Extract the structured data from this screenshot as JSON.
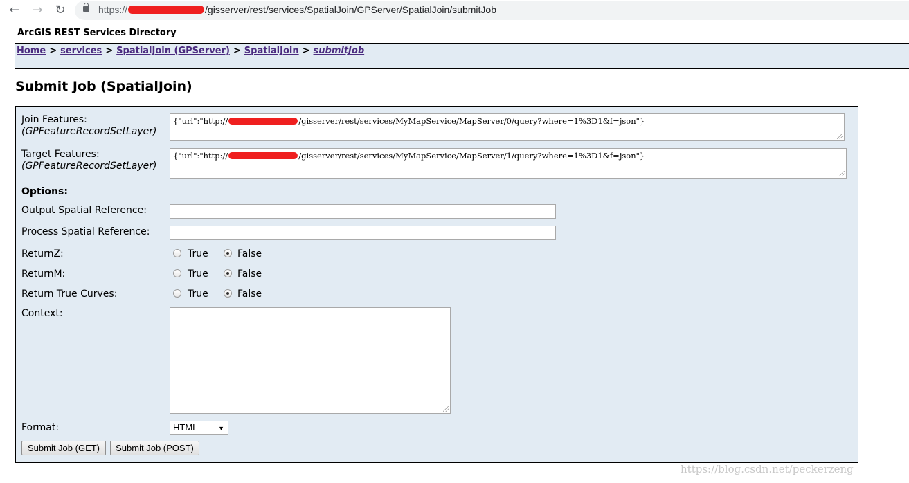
{
  "browser": {
    "url_scheme": "https://",
    "url_path": "/gisserver/rest/services/SpatialJoin/GPServer/SpatialJoin/submitJob"
  },
  "page": {
    "directory_title": "ArcGIS REST Services Directory",
    "breadcrumbs": {
      "home": "Home",
      "services": "services",
      "spatialjoin_gp": "SpatialJoin (GPServer)",
      "spatialjoin": "SpatialJoin",
      "current": "submitJob",
      "separator": ">"
    },
    "title": "Submit Job (SpatialJoin)"
  },
  "form": {
    "join_features": {
      "label": "Join Features:",
      "type": "(GPFeatureRecordSetLayer)",
      "value_prefix": "{\"url\":\"http://",
      "value_suffix": "/gisserver/rest/services/MyMapService/MapServer/0/query?where=1%3D1&f=json\"}"
    },
    "target_features": {
      "label": "Target Features:",
      "type": "(GPFeatureRecordSetLayer)",
      "value_prefix": "{\"url\":\"http://",
      "value_suffix": "/gisserver/rest/services/MyMapService/MapServer/1/query?where=1%3D1&f=json\"}"
    },
    "options_label": "Options:",
    "output_sr_label": "Output Spatial Reference:",
    "process_sr_label": "Process Spatial Reference:",
    "returnz": {
      "label": "ReturnZ:",
      "true_label": "True",
      "false_label": "False",
      "selected": "False"
    },
    "returnm": {
      "label": "ReturnM:",
      "true_label": "True",
      "false_label": "False",
      "selected": "False"
    },
    "return_true_curves": {
      "label": "Return True Curves:",
      "true_label": "True",
      "false_label": "False",
      "selected": "False"
    },
    "context_label": "Context:",
    "format_label": "Format:",
    "format_value": "HTML",
    "submit_get": "Submit Job (GET)",
    "submit_post": "Submit Job (POST)"
  },
  "watermark": "https://blog.csdn.net/peckerzeng",
  "colors": {
    "panel_bg": "#e2ebf3",
    "link": "#4b2b7f",
    "redaction": "#ef1f1f"
  }
}
